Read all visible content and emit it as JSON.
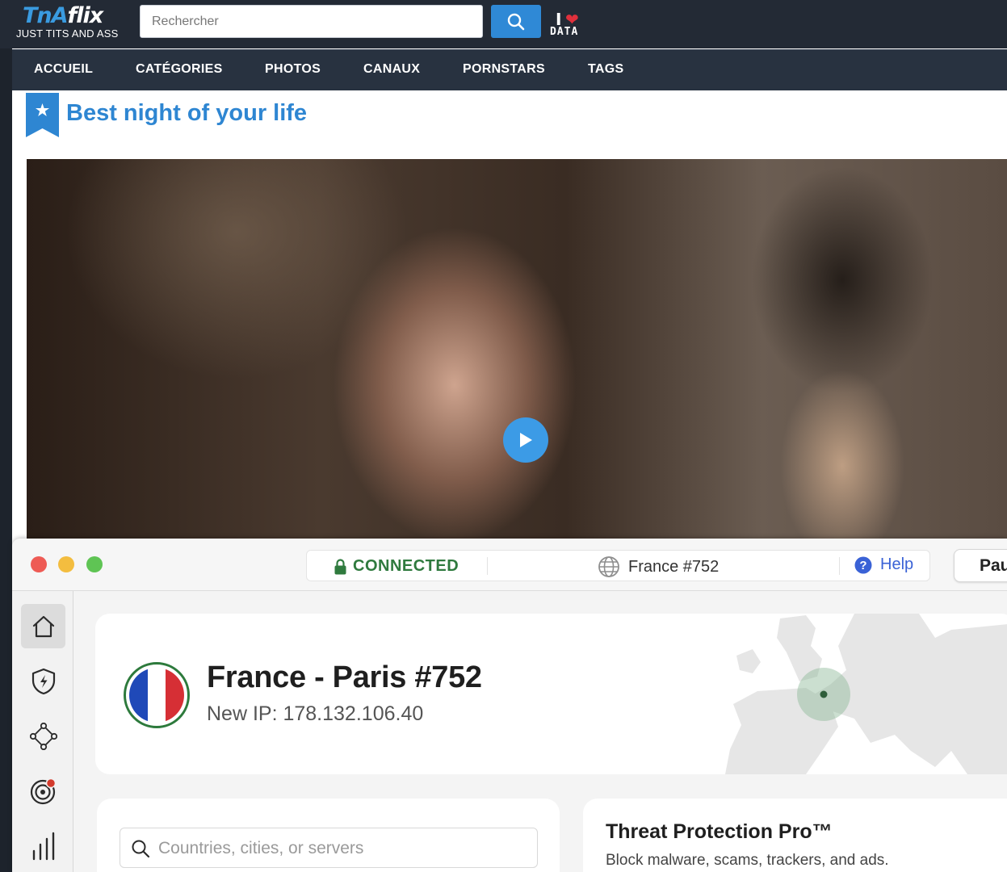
{
  "site": {
    "logo_part1": "TnA",
    "logo_part2": "flix",
    "tagline": "JUST TITS AND ASS",
    "search_placeholder": "Rechercher",
    "badge_i": "I",
    "badge_data": "DATA",
    "nav": [
      "ACCUEIL",
      "CATÉGORIES",
      "PHOTOS",
      "CANAUX",
      "PORNSTARS",
      "TAGS"
    ],
    "section_title": "Best night of your life",
    "colors": {
      "header_bg": "#232a35",
      "nav_bg": "#283240",
      "accent": "#2e86d2",
      "heart": "#e0303c"
    }
  },
  "vpn": {
    "status": "CONNECTED",
    "server": "France #752",
    "help": "Help",
    "pause": "Pau",
    "location": "France - Paris #752",
    "ip": "New IP: 178.132.106.40",
    "search_placeholder": "Countries, cities, or servers",
    "threat_title": "Threat Protection Pro™",
    "threat_desc": "Block malware, scams, trackers, and ads.",
    "rail_icons": [
      "home-icon",
      "threat-protection-icon",
      "meshnet-icon",
      "dark-web-monitor-icon",
      "statistics-icon"
    ],
    "colors": {
      "connected": "#2f7a3e",
      "help": "#3a62d6",
      "flag_blue": "#1f49b8",
      "flag_red": "#d62f35"
    }
  }
}
